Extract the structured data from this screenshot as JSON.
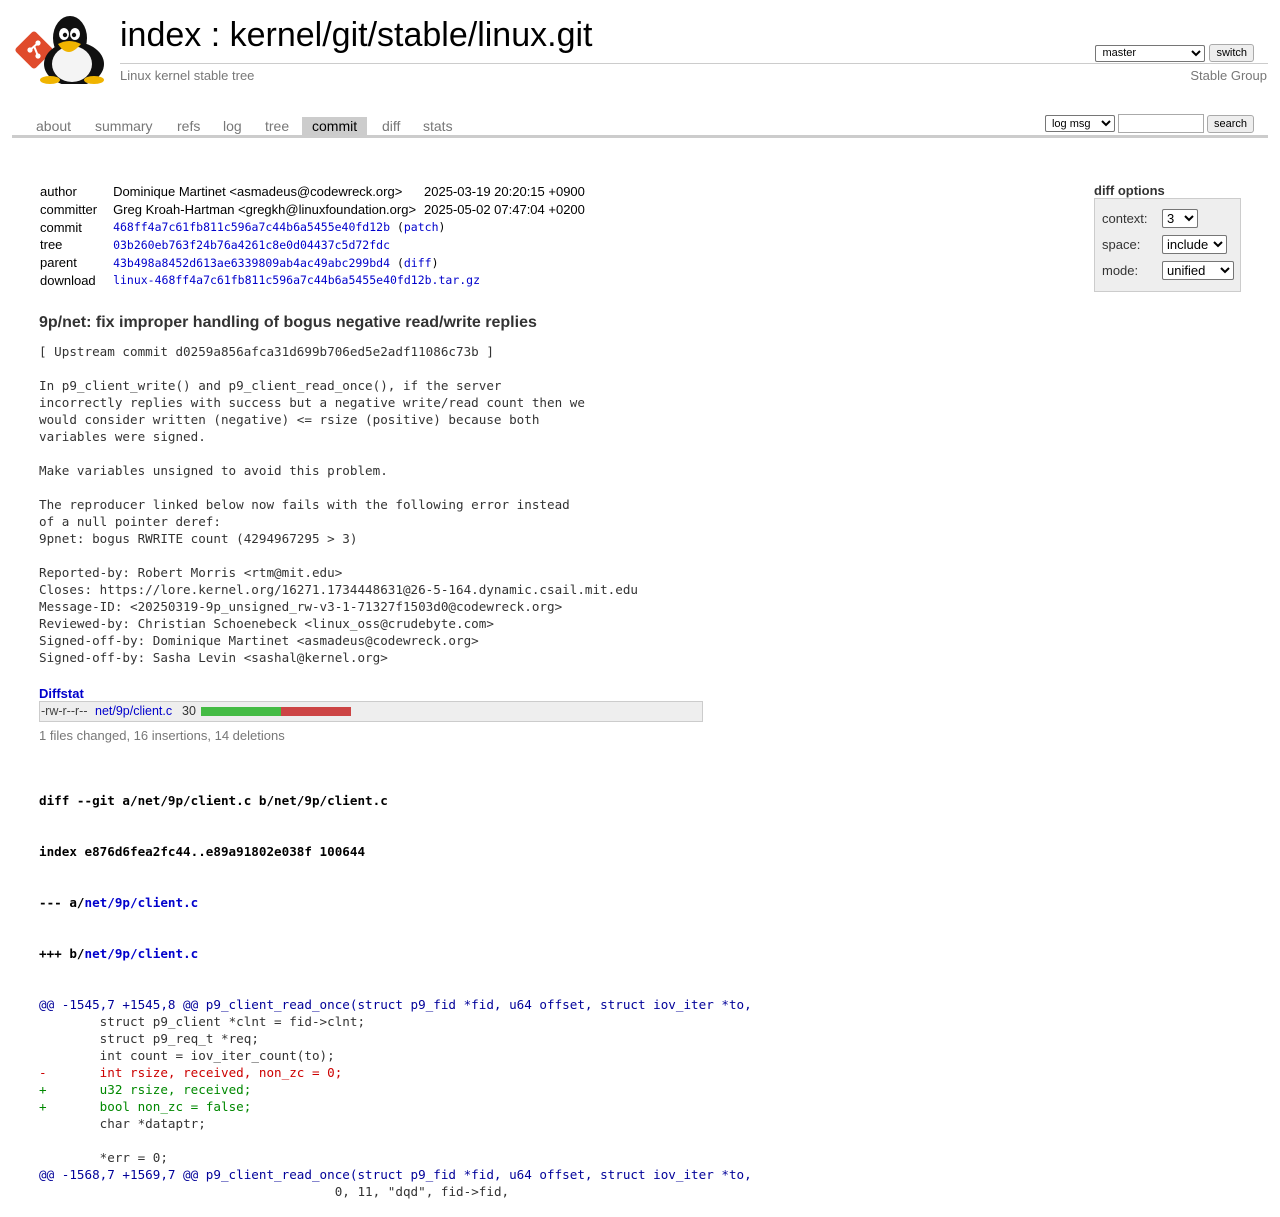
{
  "header": {
    "title_prefix": "index",
    "title_sep": " : ",
    "title_repo": "kernel/git/stable/linux.git",
    "subtitle": "Linux kernel stable tree",
    "owner": "Stable Group",
    "branch_selected": "master",
    "switch_label": "switch"
  },
  "tabs": [
    {
      "label": "about"
    },
    {
      "label": "summary"
    },
    {
      "label": "refs"
    },
    {
      "label": "log"
    },
    {
      "label": "tree"
    },
    {
      "label": "commit"
    },
    {
      "label": "diff"
    },
    {
      "label": "stats"
    }
  ],
  "active_tab": "commit",
  "search": {
    "mode_selected": "log msg",
    "query": "",
    "button_label": "search"
  },
  "commit_info": {
    "author_label": "author",
    "author": "Dominique Martinet <asmadeus@codewreck.org>",
    "author_date": "2025-03-19 20:20:15 +0900",
    "committer_label": "committer",
    "committer": "Greg Kroah-Hartman <gregkh@linuxfoundation.org>",
    "committer_date": "2025-05-02 07:47:04 +0200",
    "commit_label": "commit",
    "commit": "468ff4a7c61fb811c596a7c44b6a5455e40fd12b",
    "patch_link": "patch",
    "tree_label": "tree",
    "tree": "03b260eb763f24b76a4261c8e0d04437c5d72fdc",
    "parent_label": "parent",
    "parent": "43b498a8452d613ae6339809ab4ac49abc299bd4",
    "diff_link": "diff",
    "download_label": "download",
    "download": "linux-468ff4a7c61fb811c596a7c44b6a5455e40fd12b.tar.gz"
  },
  "diff_options": {
    "title": "diff options",
    "context_label": "context:",
    "context_value": "3",
    "space_label": "space:",
    "space_value": "include",
    "mode_label": "mode:",
    "mode_value": "unified"
  },
  "message": {
    "subject": "9p/net: fix improper handling of bogus negative read/write replies",
    "body": "[ Upstream commit d0259a856afca31d699b706ed5e2adf11086c73b ]\n\nIn p9_client_write() and p9_client_read_once(), if the server\nincorrectly replies with success but a negative write/read count then we\nwould consider written (negative) <= rsize (positive) because both\nvariables were signed.\n\nMake variables unsigned to avoid this problem.\n\nThe reproducer linked below now fails with the following error instead\nof a null pointer deref:\n9pnet: bogus RWRITE count (4294967295 > 3)\n\nReported-by: Robert Morris <rtm@mit.edu>\nCloses: https://lore.kernel.org/16271.1734448631@26-5-164.dynamic.csail.mit.edu\nMessage-ID: <20250319-9p_unsigned_rw-v3-1-71327f1503d0@codewreck.org>\nReviewed-by: Christian Schoenebeck <linux_oss@crudebyte.com>\nSigned-off-by: Dominique Martinet <asmadeus@codewreck.org>\nSigned-off-by: Sasha Levin <sashal@kernel.org>"
  },
  "diffstat": {
    "header": "Diffstat",
    "mode": "-rw-r--r--",
    "file": "net/9p/client.c",
    "changes": "30",
    "insertions": 16,
    "deletions": 14,
    "insert_color": "#44bb44",
    "delete_color": "#cc4444",
    "summary": "1 files changed, 16 insertions, 14 deletions"
  },
  "diff": {
    "git_line": "diff --git a/net/9p/client.c b/net/9p/client.c",
    "index_line": "index e876d6fea2fc44..e89a91802e038f 100644",
    "minus_prefix": "--- a/",
    "plus_prefix": "+++ b/",
    "file": "net/9p/client.c",
    "lines": [
      {
        "type": "hunk",
        "text": "@@ -1545,7 +1545,8 @@ p9_client_read_once(struct p9_fid *fid, u64 offset, struct iov_iter *to,"
      },
      {
        "type": "ctx",
        "text": " \tstruct p9_client *clnt = fid->clnt;"
      },
      {
        "type": "ctx",
        "text": " \tstruct p9_req_t *req;"
      },
      {
        "type": "ctx",
        "text": " \tint count = iov_iter_count(to);"
      },
      {
        "type": "del",
        "text": "-\tint rsize, received, non_zc = 0;"
      },
      {
        "type": "add",
        "text": "+\tu32 rsize, received;"
      },
      {
        "type": "add",
        "text": "+\tbool non_zc = false;"
      },
      {
        "type": "ctx",
        "text": " \tchar *dataptr;"
      },
      {
        "type": "ctx",
        "text": " "
      },
      {
        "type": "ctx",
        "text": " \t*err = 0;"
      },
      {
        "type": "hunk",
        "text": "@@ -1568,7 +1569,7 @@ p9_client_read_once(struct p9_fid *fid, u64 offset, struct iov_iter *to,"
      },
      {
        "type": "ctx",
        "text": " \t\t\t\t       0, 11, \"dqd\", fid->fid,"
      }
    ]
  }
}
